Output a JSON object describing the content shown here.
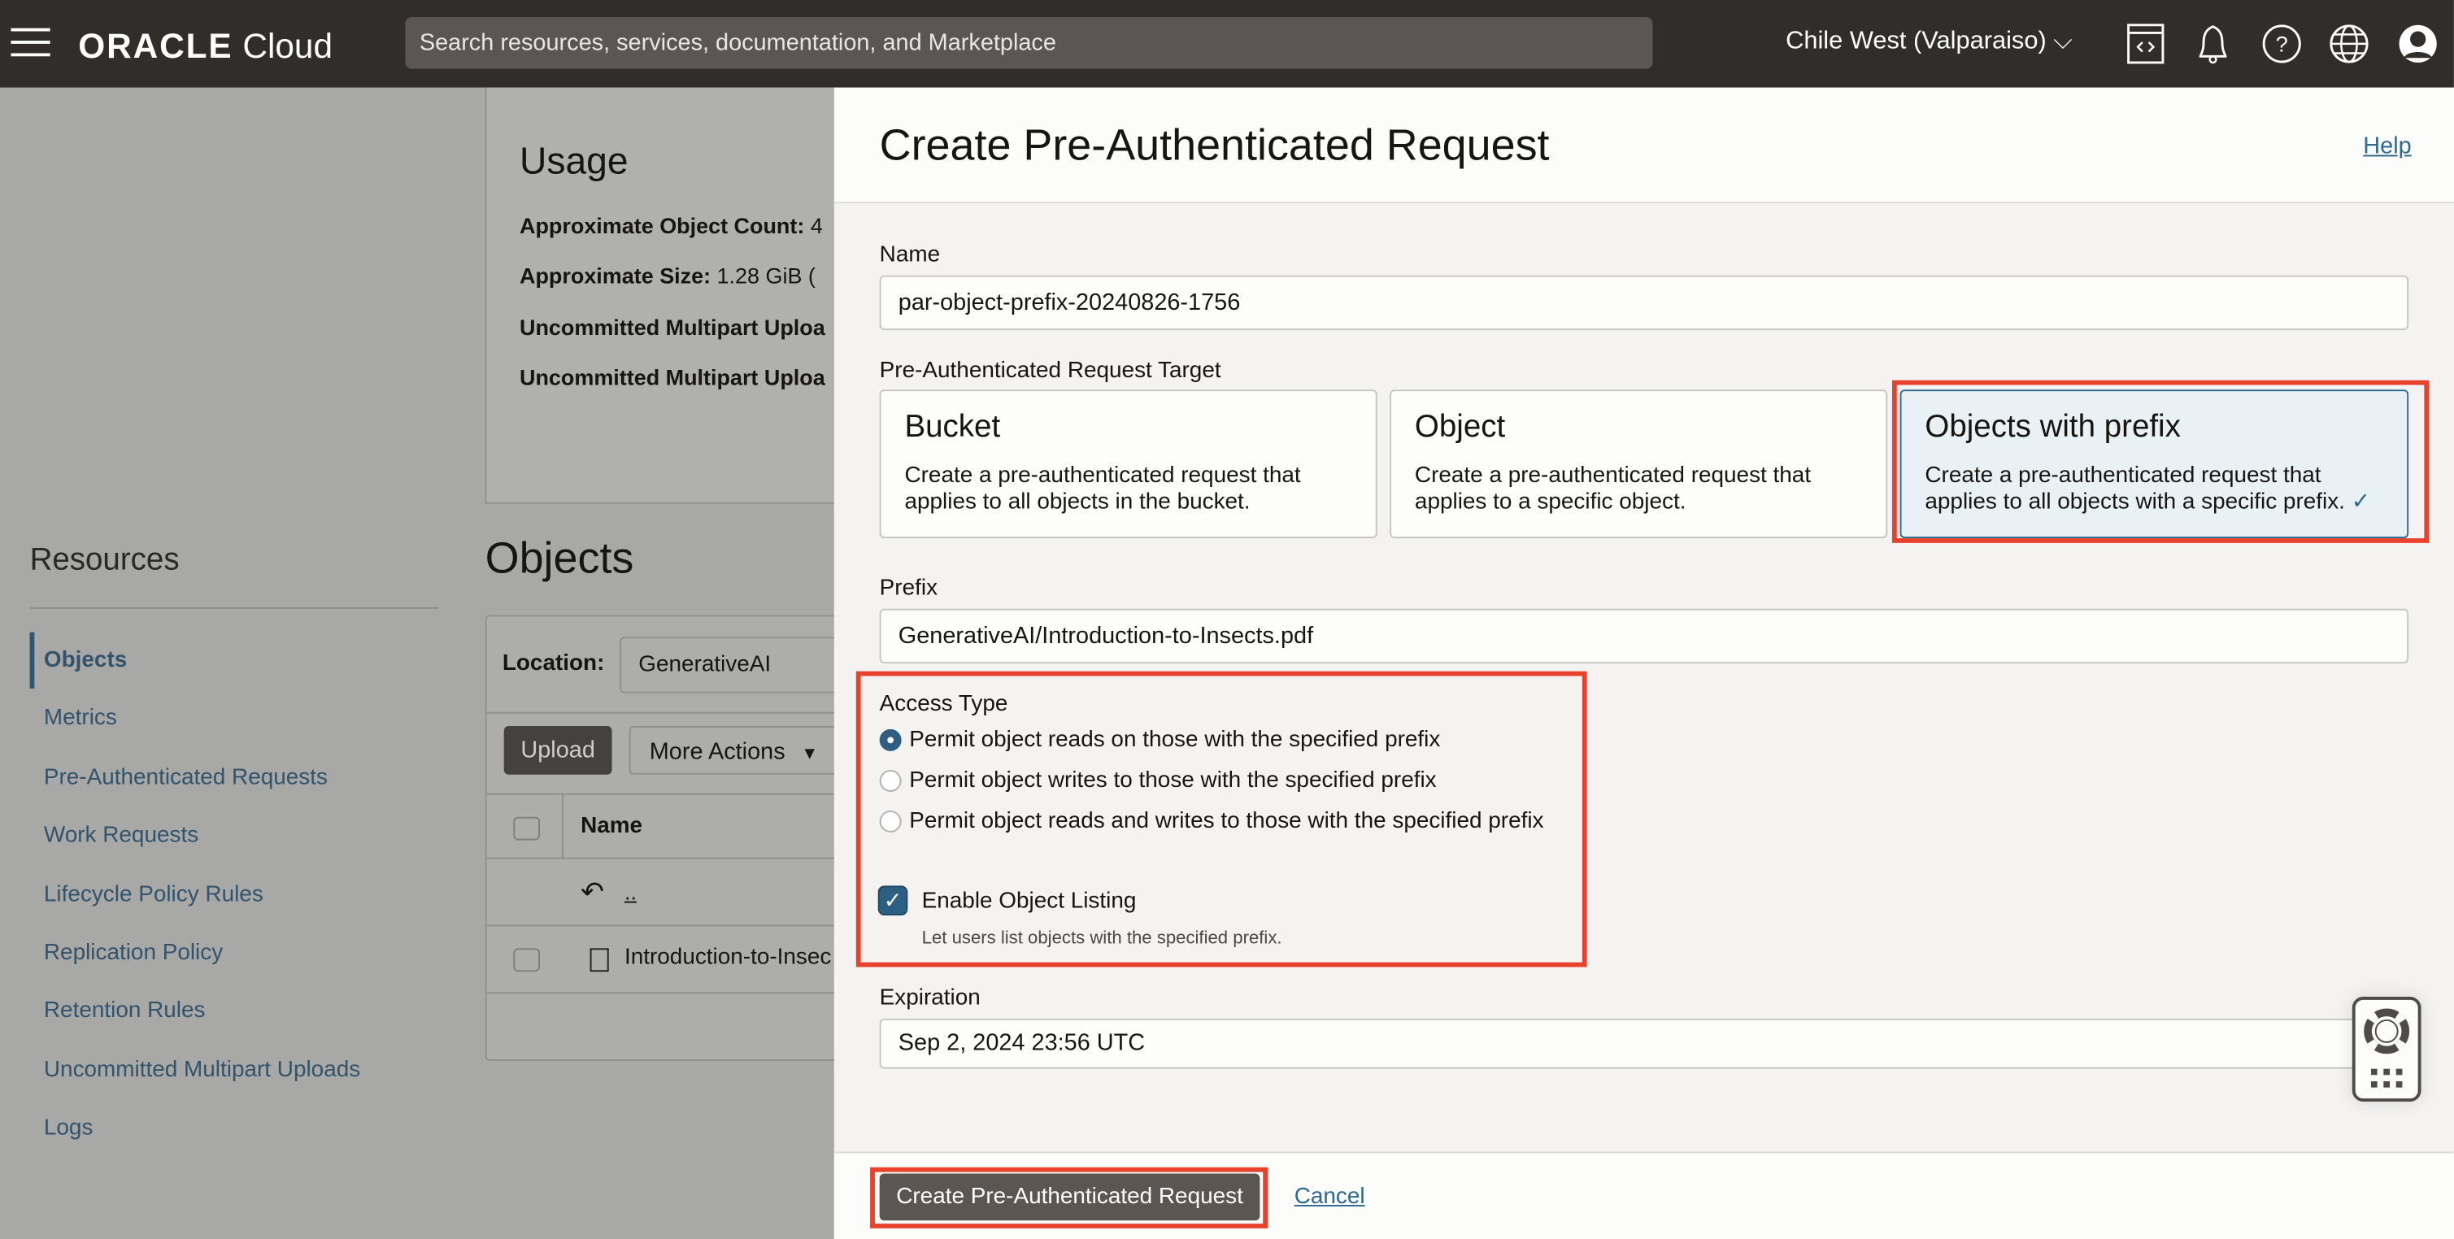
{
  "topbar": {
    "logo_brand": "ORACLE",
    "logo_product": "Cloud",
    "search_placeholder": "Search resources, services, documentation, and Marketplace",
    "region": "Chile West (Valparaiso)",
    "icons": [
      "developer-tools-icon",
      "notifications-bell-icon",
      "help-icon",
      "language-globe-icon",
      "profile-avatar-icon"
    ]
  },
  "usage": {
    "title": "Usage",
    "rows": [
      {
        "label": "Approximate Object Count:",
        "value": "4"
      },
      {
        "label": "Approximate Size:",
        "value": "1.28 GiB  ("
      },
      {
        "label": "Uncommitted Multipart Uploa",
        "value": ""
      },
      {
        "label": "Uncommitted Multipart Uploa",
        "value": ""
      }
    ]
  },
  "resources": {
    "title": "Resources",
    "items": [
      "Objects",
      "Metrics",
      "Pre-Authenticated Requests",
      "Work Requests",
      "Lifecycle Policy Rules",
      "Replication Policy",
      "Retention Rules",
      "Uncommitted Multipart Uploads",
      "Logs"
    ]
  },
  "objects": {
    "title": "Objects",
    "location_label": "Location:",
    "location_value": "GenerativeAI",
    "upload": "Upload",
    "more_actions": "More Actions",
    "col_name": "Name",
    "parent_link": "..",
    "rows": [
      "Introduction-to-Insec"
    ]
  },
  "dialog": {
    "title": "Create Pre-Authenticated Request",
    "help": "Help",
    "name_label": "Name",
    "name_value": "par-object-prefix-20240826-1756",
    "target_label": "Pre-Authenticated Request Target",
    "targets": [
      {
        "title": "Bucket",
        "desc": "Create a pre-authenticated request that applies to all objects in the bucket."
      },
      {
        "title": "Object",
        "desc": "Create a pre-authenticated request that applies to a specific object."
      },
      {
        "title": "Objects with prefix",
        "desc": "Create a pre-authenticated request that applies to all objects with a specific prefix.",
        "check": "✓"
      }
    ],
    "prefix_label": "Prefix",
    "prefix_value": "GenerativeAI/Introduction-to-Insects.pdf",
    "access_label": "Access Type",
    "access_options": [
      "Permit object reads on those with the specified prefix",
      "Permit object writes to those with the specified prefix",
      "Permit object reads and writes to those with the specified prefix"
    ],
    "enable_listing_label": "Enable Object Listing",
    "enable_listing_help": "Let users list objects with the specified prefix.",
    "expiration_label": "Expiration",
    "expiration_value": "Sep 2, 2024 23:56 UTC",
    "create_button": "Create Pre-Authenticated Request",
    "cancel": "Cancel"
  },
  "colors": {
    "highlight": "#e8412c",
    "accent": "#2c6a8f",
    "topbar": "#312d2a"
  }
}
